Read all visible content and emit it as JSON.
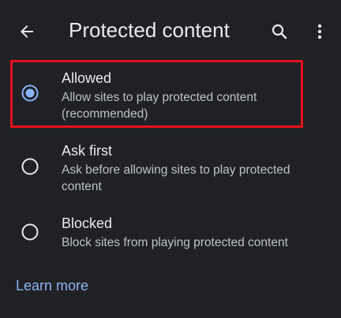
{
  "appbar": {
    "title": "Protected content",
    "back_icon": "arrow-back-icon",
    "search_icon": "search-icon",
    "more_icon": "more-vert-icon"
  },
  "options": [
    {
      "label": "Allowed",
      "description": "Allow sites to play protected content (recommended)",
      "selected": true
    },
    {
      "label": "Ask first",
      "description": "Ask before allowing sites to play protected content",
      "selected": false
    },
    {
      "label": "Blocked",
      "description": "Block sites from playing protected content",
      "selected": false
    }
  ],
  "footer": {
    "learn_more": "Learn more"
  },
  "colors": {
    "background": "#202124",
    "text_primary": "#e8eaed",
    "text_secondary": "#bdc1c6",
    "accent": "#8ab4f8",
    "highlight": "#e3121b"
  }
}
